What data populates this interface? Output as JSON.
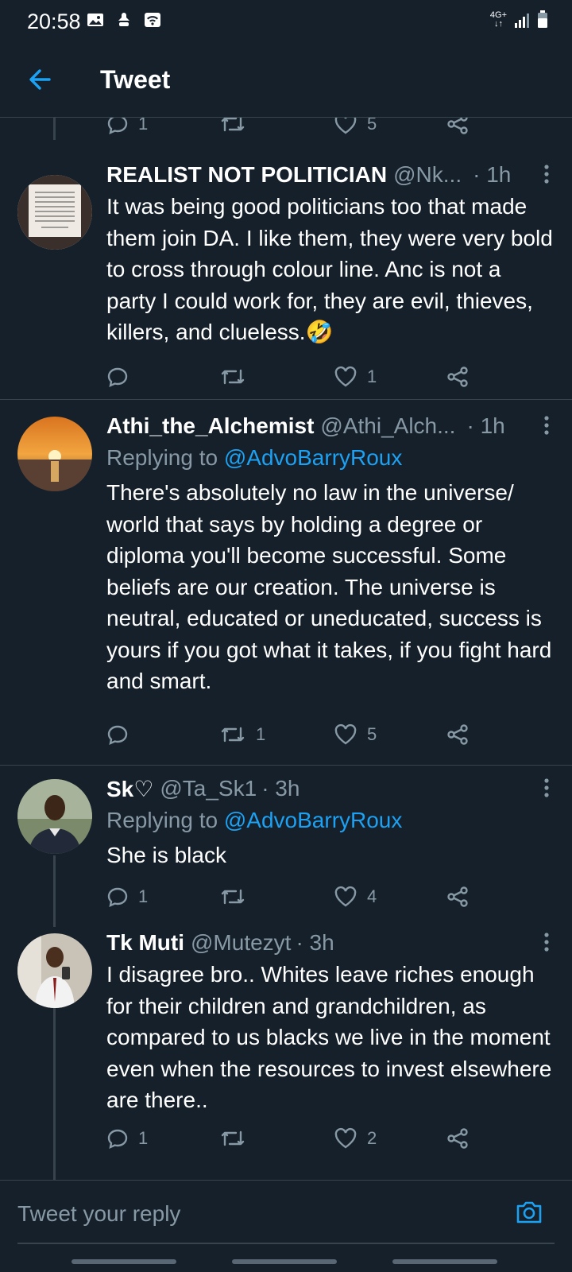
{
  "status_bar": {
    "time": "20:58",
    "network": "4G+"
  },
  "header": {
    "title": "Tweet"
  },
  "top_partial_actions": {
    "reply_count": "1",
    "like_count": "5"
  },
  "tweets": [
    {
      "name": "REALIST NOT POLITICIAN",
      "handle": "@Nk...",
      "time": "· 1h",
      "replying_prefix": "",
      "replying_to": "",
      "text": "It was being good politicians too that made them join DA. I like them, they were very bold to cross through colour line. Anc is not a party I could work for, they are evil, thieves, killers, and clueless.🤣",
      "reply_count": "",
      "retweet_count": "",
      "like_count": "1",
      "avatar_desc": "quote-avatar"
    },
    {
      "name": "Athi_the_Alchemist",
      "handle": "@Athi_Alch...",
      "time": "· 1h",
      "replying_prefix": "Replying to",
      "replying_to": "@AdvoBarryRoux",
      "text": "There's absolutely no law in the universe/ world that says by holding a degree or diploma you'll become successful. Some beliefs are our creation. The universe is neutral, educated or uneducated, success is yours if you got what it takes, if you fight hard and smart.",
      "reply_count": "",
      "retweet_count": "1",
      "like_count": "5",
      "avatar_desc": "sunset-avatar"
    },
    {
      "name": "Sk♡",
      "handle": "@Ta_Sk1",
      "time": "· 3h",
      "replying_prefix": "Replying to",
      "replying_to": "@AdvoBarryRoux",
      "text": "She is black",
      "reply_count": "1",
      "retweet_count": "",
      "like_count": "4",
      "avatar_desc": "person-avatar"
    },
    {
      "name": "Tk Muti",
      "handle": "@Mutezyt",
      "time": "· 3h",
      "replying_prefix": "",
      "replying_to": "",
      "text": "I disagree bro.. Whites leave riches enough for their children and grandchildren, as compared to us blacks we live in the moment even when the resources to invest elsewhere are there..",
      "reply_count": "1",
      "retweet_count": "",
      "like_count": "2",
      "avatar_desc": "selfie-avatar"
    }
  ],
  "reply_bar": {
    "placeholder": "Tweet your reply"
  },
  "colors": {
    "background": "#15202b",
    "text_secondary": "#8899a6",
    "accent": "#1da1f2",
    "divider": "#38444d"
  }
}
